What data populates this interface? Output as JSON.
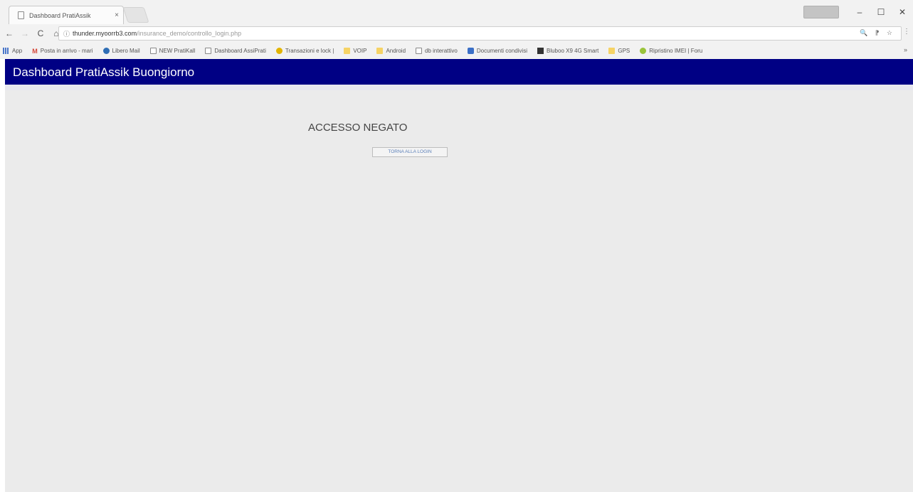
{
  "browser": {
    "tab": {
      "title": "Dashboard PratiAssik",
      "close": "×"
    },
    "window_controls": {
      "minimize": "–",
      "maximize": "☐",
      "close": "✕"
    },
    "nav": {
      "back": "←",
      "forward": "→",
      "reload": "C",
      "home": "⌂"
    },
    "address": {
      "host": "thunder.myoorrb3.com",
      "path": "/insurance_demo/controllo_login.php",
      "info": "ⓘ",
      "right_icons": "🔍 ⁋ ☆"
    },
    "menu": "⋮",
    "bookmarks": [
      {
        "label": "App",
        "icon": "apps-icon"
      },
      {
        "label": "Posta in arrivo - mari",
        "icon": "gmail-icon"
      },
      {
        "label": "Libero Mail",
        "icon": "libero-icon"
      },
      {
        "label": "NEW PratiKall",
        "icon": "page-icon"
      },
      {
        "label": "Dashboard AssiPrati",
        "icon": "page-icon"
      },
      {
        "label": "Transazioni e lock |",
        "icon": "yellow-icon"
      },
      {
        "label": "VOIP",
        "icon": "folder-icon"
      },
      {
        "label": "Android",
        "icon": "folder-icon"
      },
      {
        "label": "db interattivo",
        "icon": "page-icon"
      },
      {
        "label": "Documenti condivisi",
        "icon": "docs-icon"
      },
      {
        "label": "Bluboo X9 4G Smart",
        "icon": "dark-icon"
      },
      {
        "label": "GPS",
        "icon": "folder-icon"
      },
      {
        "label": "Ripristino IMEI | Foru",
        "icon": "green-icon"
      }
    ],
    "bookmarks_more": "»"
  },
  "page": {
    "header_title": "Dashboard PratiAssik Buongiorno",
    "message": "ACCESSO NEGATO",
    "back_button": "TORNA ALLA LOGIN"
  },
  "colors": {
    "header_bg": "#000084",
    "page_bg": "#ebebeb"
  }
}
